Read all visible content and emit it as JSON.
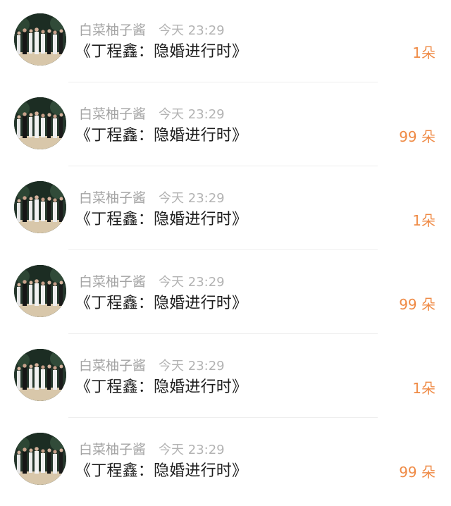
{
  "feed": {
    "items": [
      {
        "name": "白菜柚子酱",
        "time": "今天 23:29",
        "message": "《丁程鑫：隐婚进行时》",
        "amount": "1朵"
      },
      {
        "name": "白菜柚子酱",
        "time": "今天 23:29",
        "message": "《丁程鑫：隐婚进行时》",
        "amount": "99 朵"
      },
      {
        "name": "白菜柚子酱",
        "time": "今天 23:29",
        "message": "《丁程鑫：隐婚进行时》",
        "amount": "1朵"
      },
      {
        "name": "白菜柚子酱",
        "time": "今天 23:29",
        "message": "《丁程鑫：隐婚进行时》",
        "amount": "99 朵"
      },
      {
        "name": "白菜柚子酱",
        "time": "今天 23:29",
        "message": "《丁程鑫：隐婚进行时》",
        "amount": "1朵"
      },
      {
        "name": "白菜柚子酱",
        "time": "今天 23:29",
        "message": "《丁程鑫：隐婚进行时》",
        "amount": "99 朵"
      }
    ],
    "colors": {
      "amount": "#ef8a45",
      "name": "#a4a4a4",
      "message": "#1d1d1d"
    }
  }
}
